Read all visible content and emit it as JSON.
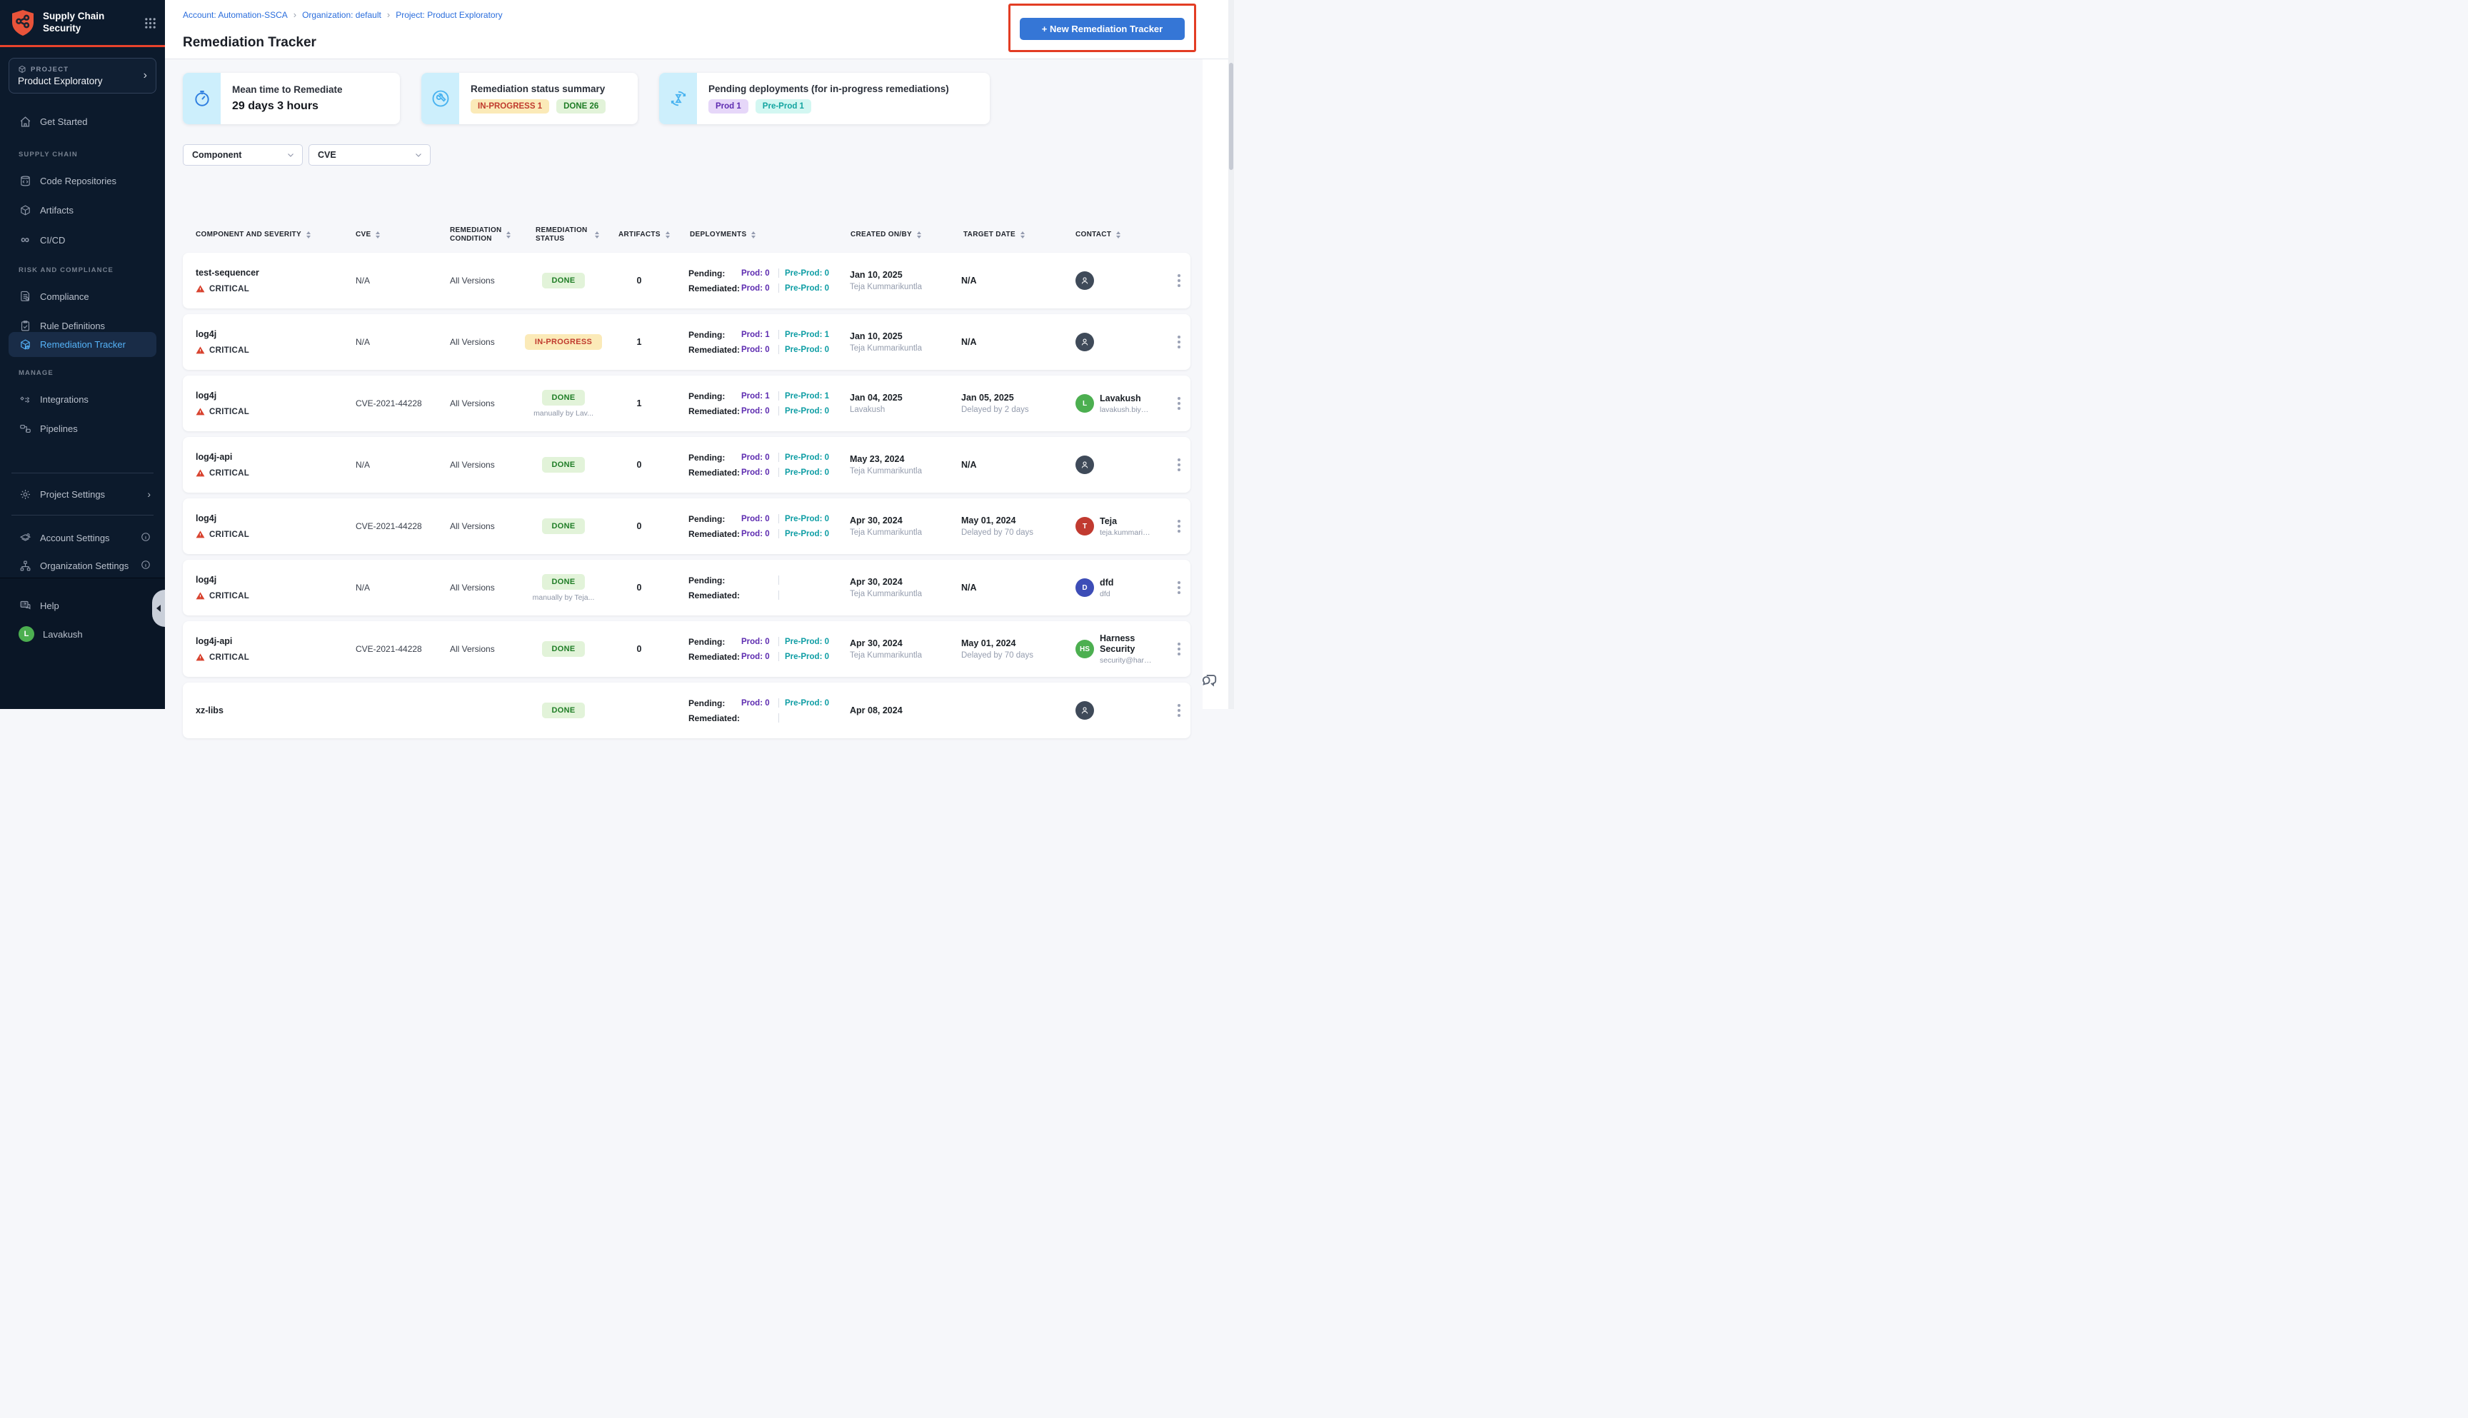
{
  "icons": {
    "breadcrumb_separator": "›",
    "chevron_right": "›",
    "cicd_infinity": "∞"
  },
  "sidebar": {
    "app_title": "Supply Chain Security",
    "project": {
      "label": "PROJECT",
      "name": "Product Exploratory"
    },
    "sections": {
      "supply_chain": "SUPPLY CHAIN",
      "risk_and_compliance": "RISK AND COMPLIANCE",
      "manage": "MANAGE"
    },
    "items": {
      "get_started": "Get Started",
      "code_repositories": "Code Repositories",
      "artifacts": "Artifacts",
      "cicd": "CI/CD",
      "compliance": "Compliance",
      "rule_definitions": "Rule Definitions",
      "remediation_tracker": "Remediation Tracker",
      "integrations": "Integrations",
      "pipelines": "Pipelines",
      "project_settings": "Project Settings",
      "account_settings": "Account Settings",
      "organization_settings": "Organization Settings",
      "help": "Help"
    },
    "user": {
      "name": "Lavakush",
      "initial": "L"
    }
  },
  "header": {
    "breadcrumb": [
      {
        "label": "Account: Automation-SSCA"
      },
      {
        "label": "Organization: default"
      },
      {
        "label": "Project: Product Exploratory"
      }
    ],
    "title": "Remediation Tracker",
    "new_button": "+ New Remediation Tracker"
  },
  "cards": {
    "mttr": {
      "title": "Mean time to Remediate",
      "value": "29 days 3 hours"
    },
    "status_summary": {
      "title": "Remediation status summary",
      "in_progress_badge": "IN-PROGRESS 1",
      "done_badge": "DONE 26"
    },
    "pending_deployments": {
      "title": "Pending deployments (for in-progress remediations)",
      "prod_badge": "Prod 1",
      "preprod_badge": "Pre-Prod 1"
    }
  },
  "filters": {
    "component": "Component",
    "cve": "CVE"
  },
  "table": {
    "headers": [
      "COMPONENT AND SEVERITY",
      "CVE",
      "REMEDIATION CONDITION",
      "REMEDIATION STATUS",
      "ARTIFACTS",
      "DEPLOYMENTS",
      "CREATED ON/BY",
      "TARGET DATE",
      "CONTACT"
    ],
    "dep_labels": {
      "pending": "Pending:",
      "remediated": "Remediated:"
    },
    "rows": [
      {
        "component": "test-sequencer",
        "severity": "CRITICAL",
        "cve": "N/A",
        "condition": "All Versions",
        "status": "DONE",
        "status_note": "",
        "artifacts": "0",
        "pending_prod": "Prod: 0",
        "pending_preprod": "Pre-Prod: 0",
        "remediated_prod": "Prod: 0",
        "remediated_preprod": "Pre-Prod: 0",
        "created_date": "Jan 10, 2025",
        "created_by": "Teja Kummarikuntla",
        "target_date": "N/A",
        "target_note": "",
        "contact": {
          "avatar": "slate",
          "initial": "",
          "name": "",
          "email": ""
        }
      },
      {
        "component": "log4j",
        "severity": "CRITICAL",
        "cve": "N/A",
        "condition": "All Versions",
        "status": "IN-PROGRESS",
        "status_note": "",
        "artifacts": "1",
        "pending_prod": "Prod: 1",
        "pending_preprod": "Pre-Prod: 1",
        "remediated_prod": "Prod: 0",
        "remediated_preprod": "Pre-Prod: 0",
        "created_date": "Jan 10, 2025",
        "created_by": "Teja Kummarikuntla",
        "target_date": "N/A",
        "target_note": "",
        "contact": {
          "avatar": "slate",
          "initial": "",
          "name": "",
          "email": ""
        }
      },
      {
        "component": "log4j",
        "severity": "CRITICAL",
        "cve": "CVE-2021-44228",
        "condition": "All Versions",
        "status": "DONE",
        "status_note": "manually by Lav...",
        "artifacts": "1",
        "pending_prod": "Prod: 1",
        "pending_preprod": "Pre-Prod: 1",
        "remediated_prod": "Prod: 0",
        "remediated_preprod": "Pre-Prod: 0",
        "created_date": "Jan 04, 2025",
        "created_by": "Lavakush",
        "target_date": "Jan 05, 2025",
        "target_note": "Delayed by 2 days",
        "contact": {
          "avatar": "green",
          "initial": "L",
          "name": "Lavakush",
          "email": "lavakush.biyan..."
        }
      },
      {
        "component": "log4j-api",
        "severity": "CRITICAL",
        "cve": "N/A",
        "condition": "All Versions",
        "status": "DONE",
        "status_note": "",
        "artifacts": "0",
        "pending_prod": "Prod: 0",
        "pending_preprod": "Pre-Prod: 0",
        "remediated_prod": "Prod: 0",
        "remediated_preprod": "Pre-Prod: 0",
        "created_date": "May 23, 2024",
        "created_by": "Teja Kummarikuntla",
        "target_date": "N/A",
        "target_note": "",
        "contact": {
          "avatar": "slate",
          "initial": "",
          "name": "",
          "email": ""
        }
      },
      {
        "component": "log4j",
        "severity": "CRITICAL",
        "cve": "CVE-2021-44228",
        "condition": "All Versions",
        "status": "DONE",
        "status_note": "",
        "artifacts": "0",
        "pending_prod": "Prod: 0",
        "pending_preprod": "Pre-Prod: 0",
        "remediated_prod": "Prod: 0",
        "remediated_preprod": "Pre-Prod: 0",
        "created_date": "Apr 30, 2024",
        "created_by": "Teja Kummarikuntla",
        "target_date": "May 01, 2024",
        "target_note": "Delayed by 70 days",
        "contact": {
          "avatar": "red",
          "initial": "T",
          "name": "Teja",
          "email": "teja.kummarik..."
        }
      },
      {
        "component": "log4j",
        "severity": "CRITICAL",
        "cve": "N/A",
        "condition": "All Versions",
        "status": "DONE",
        "status_note": "manually by Teja...",
        "artifacts": "0",
        "pending_prod": "",
        "pending_preprod": "",
        "remediated_prod": "",
        "remediated_preprod": "",
        "created_date": "Apr 30, 2024",
        "created_by": "Teja Kummarikuntla",
        "target_date": "N/A",
        "target_note": "",
        "contact": {
          "avatar": "indigo",
          "initial": "D",
          "name": "dfd",
          "email": "dfd"
        }
      },
      {
        "component": "log4j-api",
        "severity": "CRITICAL",
        "cve": "CVE-2021-44228",
        "condition": "All Versions",
        "status": "DONE",
        "status_note": "",
        "artifacts": "0",
        "pending_prod": "Prod: 0",
        "pending_preprod": "Pre-Prod: 0",
        "remediated_prod": "Prod: 0",
        "remediated_preprod": "Pre-Prod: 0",
        "created_date": "Apr 30, 2024",
        "created_by": "Teja Kummarikuntla",
        "target_date": "May 01, 2024",
        "target_note": "Delayed by 70 days",
        "contact": {
          "avatar": "green",
          "initial": "HS",
          "name": "Harness Security",
          "email": "security@harn..."
        }
      },
      {
        "component": "xz-libs",
        "severity": "",
        "cve": "",
        "condition": "",
        "status": "DONE",
        "status_note": "",
        "artifacts": "",
        "pending_prod": "Prod: 0",
        "pending_preprod": "Pre-Prod: 0",
        "remediated_prod": "",
        "remediated_preprod": "",
        "created_date": "Apr 08, 2024",
        "created_by": "",
        "target_date": "",
        "target_note": "",
        "contact": {
          "avatar": "slate",
          "initial": "",
          "name": "",
          "email": ""
        }
      }
    ]
  },
  "colors": {
    "brand_orange": "#e8432c",
    "accent_blue": "#3576d6",
    "active_nav_blue": "#55b3f8",
    "done_green": "#1f7d26",
    "in_progress_red": "#c03b2e",
    "prod_purple": "#5d2bb0",
    "preprod_teal": "#12a4a0",
    "critical_red": "#d8432f",
    "annotation_red": "#e33d24"
  }
}
